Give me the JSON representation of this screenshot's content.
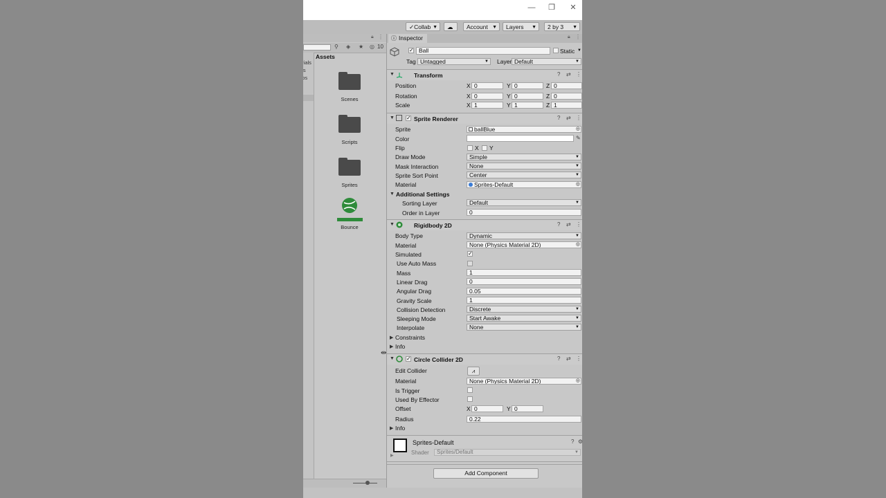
{
  "window": {
    "controls": {
      "minimize": "—",
      "restore": "❐",
      "close": "✕"
    }
  },
  "toolbar": {
    "collab": "Collab",
    "cloud_icon": "cloud-icon",
    "account": "Account",
    "layers": "Layers",
    "layout": "2 by 3"
  },
  "project": {
    "hidden_count": "10",
    "assets_label": "Assets",
    "tree_fragments": [
      "erials",
      "els",
      "abs",
      "ts"
    ],
    "assets": [
      "Scenes",
      "Scripts",
      "Sprites",
      "Bounce"
    ]
  },
  "inspector": {
    "tab_label": "Inspector",
    "object_name": "Ball",
    "static_label": "Static",
    "tag_label": "Tag",
    "tag_value": "Untagged",
    "layer_label": "Layer",
    "layer_value": "Default",
    "transform": {
      "title": "Transform",
      "position_label": "Position",
      "position": [
        "0",
        "0",
        "0"
      ],
      "rotation_label": "Rotation",
      "rotation": [
        "0",
        "0",
        "0"
      ],
      "scale_label": "Scale",
      "scale": [
        "1",
        "1",
        "1"
      ]
    },
    "sprite_renderer": {
      "title": "Sprite Renderer",
      "sprite_label": "Sprite",
      "sprite_value": "ballBlue",
      "color_label": "Color",
      "flip_label": "Flip",
      "flip_x": "X",
      "flip_y": "Y",
      "draw_mode_label": "Draw Mode",
      "draw_mode": "Simple",
      "mask_label": "Mask Interaction",
      "mask": "None",
      "sort_point_label": "Sprite Sort Point",
      "sort_point": "Center",
      "material_label": "Material",
      "material": "Sprites-Default",
      "additional_label": "Additional Settings",
      "sorting_layer_label": "Sorting Layer",
      "sorting_layer": "Default",
      "order_label": "Order in Layer",
      "order": "0"
    },
    "rigidbody": {
      "title": "Rigidbody 2D",
      "body_type_label": "Body Type",
      "body_type": "Dynamic",
      "material_label": "Material",
      "material": "None (Physics Material 2D)",
      "simulated_label": "Simulated",
      "auto_mass_label": "Use Auto Mass",
      "mass_label": "Mass",
      "mass": "1",
      "linear_drag_label": "Linear Drag",
      "linear_drag": "0",
      "angular_drag_label": "Angular Drag",
      "angular_drag": "0.05",
      "gravity_label": "Gravity Scale",
      "gravity": "1",
      "collision_label": "Collision Detection",
      "collision": "Discrete",
      "sleeping_label": "Sleeping Mode",
      "sleeping": "Start Awake",
      "interpolate_label": "Interpolate",
      "interpolate": "None",
      "constraints_label": "Constraints",
      "info_label": "Info"
    },
    "circle_collider": {
      "title": "Circle Collider 2D",
      "edit_label": "Edit Collider",
      "material_label": "Material",
      "material": "None (Physics Material 2D)",
      "trigger_label": "Is Trigger",
      "effector_label": "Used By Effector",
      "offset_label": "Offset",
      "offset": [
        "0",
        "0"
      ],
      "radius_label": "Radius",
      "radius": "0.22",
      "info_label": "Info"
    },
    "material_preview": {
      "name": "Sprites-Default",
      "shader_label": "Shader",
      "shader": "Sprites/Default"
    },
    "add_component": "Add Component"
  },
  "colors": {
    "panel": "#c8c8c8",
    "folder": "#4a4a4a",
    "bounce_green": "#2e8b3a"
  }
}
